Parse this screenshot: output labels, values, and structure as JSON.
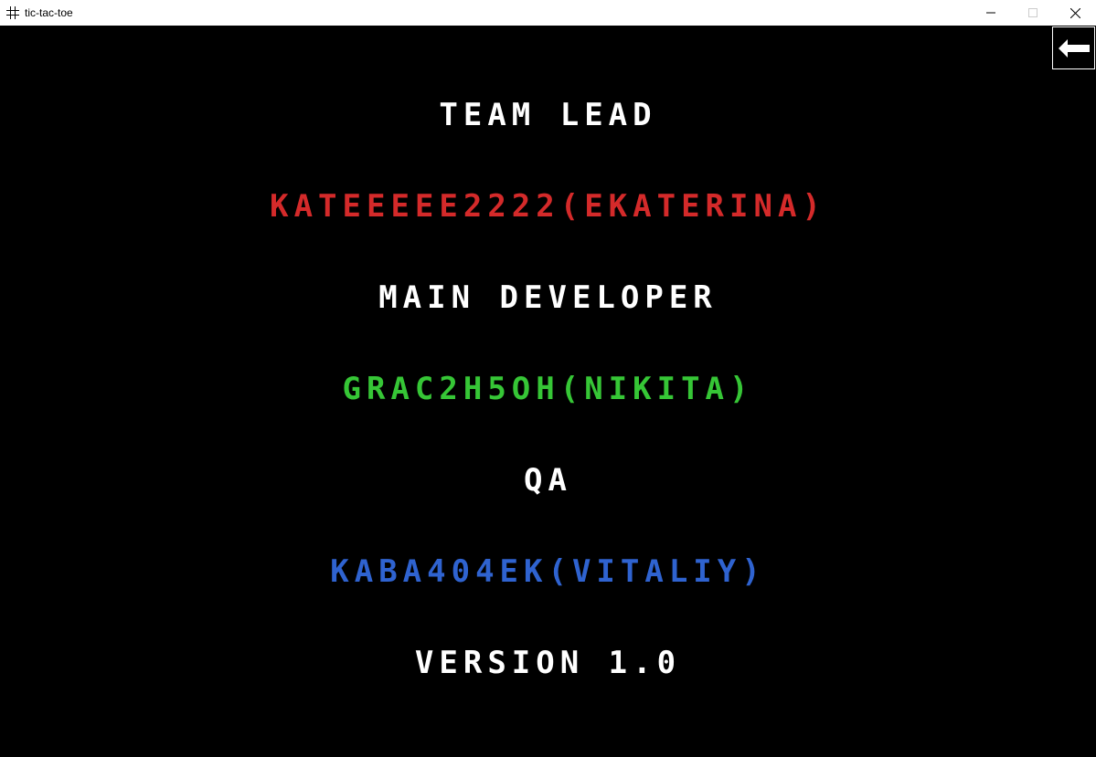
{
  "window": {
    "title": "tic-tac-toe",
    "minimize_icon": "minimize-icon",
    "maximize_icon": "maximize-icon",
    "close_icon": "close-icon"
  },
  "back_button": {
    "icon": "arrow-left-icon"
  },
  "credits": {
    "team_lead_heading": "TEAM LEAD",
    "team_lead_name": "KATEEEEE2222(EKATERINA)",
    "main_developer_heading": "MAIN DEVELOPER",
    "main_developer_name": "GRAC2H5OH(NIKITA)",
    "qa_heading": "QA",
    "qa_name": "KABA404EK(VITALIY)",
    "version": "VERSION 1.0"
  },
  "colors": {
    "background": "#000000",
    "heading": "#ffffff",
    "team_lead": "#d42a2a",
    "main_developer": "#36c636",
    "qa": "#2f63d0"
  }
}
